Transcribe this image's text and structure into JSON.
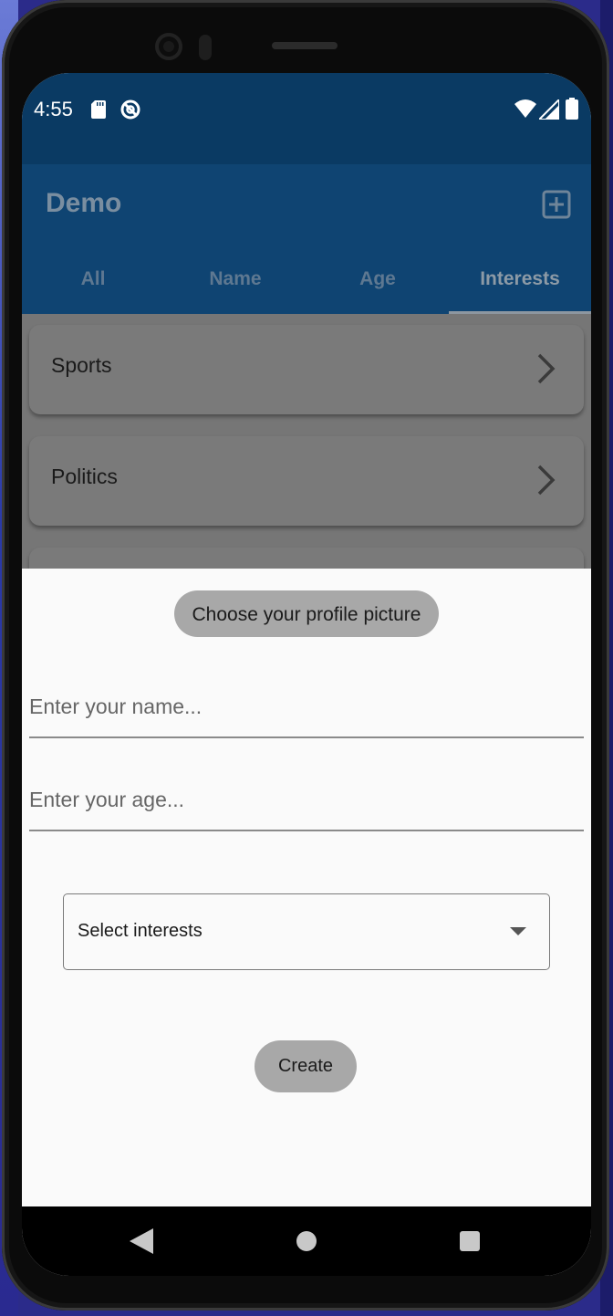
{
  "status_bar": {
    "time": "4:55"
  },
  "app_bar": {
    "title": "Demo",
    "tabs": [
      "All",
      "Name",
      "Age",
      "Interests"
    ],
    "active_tab": "Interests"
  },
  "list": {
    "items": [
      "Sports",
      "Politics"
    ]
  },
  "form": {
    "profile_picture_button": "Choose your profile picture",
    "name_placeholder": "Enter your name...",
    "age_placeholder": "Enter your age...",
    "interests_select": "Select interests",
    "create_button": "Create"
  },
  "colors": {
    "status_bar": "#0a3a63",
    "app_bar": "#0f4472",
    "sheet": "#fafafa",
    "pill_button": "#a8a8a8"
  }
}
